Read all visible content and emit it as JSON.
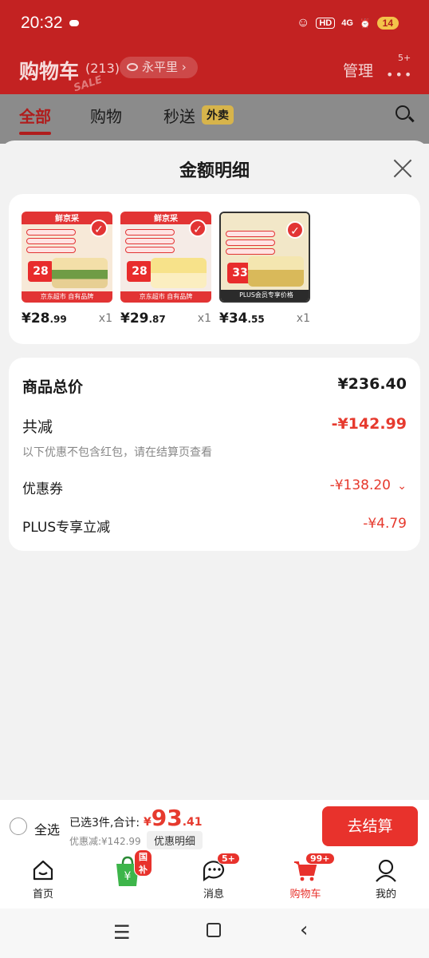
{
  "status_bar": {
    "time": "20:32",
    "hd": "HD",
    "net": "4G",
    "battery": "14"
  },
  "header": {
    "title": "购物车",
    "count": "(213)",
    "location": "永平里",
    "manage": "管理",
    "more_badge": "5+",
    "sale_sticker": "SALE"
  },
  "tabs": [
    {
      "label": "全部",
      "active": true
    },
    {
      "label": "购物",
      "active": false
    },
    {
      "label": "秒送",
      "active": false
    }
  ],
  "tab_badge": "外卖",
  "sheet": {
    "title": "金额明细",
    "products": [
      {
        "banner": "鲜京采",
        "price_int": "¥28",
        "price_dec": ".99",
        "qty": "x1",
        "box": "28",
        "foot": "京东超市 自有品牌"
      },
      {
        "banner": "鲜京采",
        "price_int": "¥29",
        "price_dec": ".87",
        "qty": "x1",
        "box": "28",
        "foot": "京东超市 自有品牌"
      },
      {
        "banner": "",
        "price_int": "¥34",
        "price_dec": ".55",
        "qty": "x1",
        "box": "33",
        "foot": "PLUS会员专享价格"
      }
    ],
    "summary": {
      "total_label": "商品总价",
      "total_value": "¥236.40",
      "discount_label": "共减",
      "discount_value": "-¥142.99",
      "note": "以下优惠不包含红包，请在结算页查看",
      "coupon_label": "优惠券",
      "coupon_value": "-¥138.20",
      "plus_label": "PLUS专享立减",
      "plus_value": "-¥4.79"
    }
  },
  "checkout_bar": {
    "select_all": "全选",
    "selected_info": "已选3件,合计:",
    "total_symbol": "¥",
    "total_int": "93",
    "total_dec": ".41",
    "saved": "优惠减:¥142.99",
    "detail_button": "优惠明细",
    "checkout_button": "去结算"
  },
  "bottom_nav": [
    {
      "label": "首页",
      "badge": ""
    },
    {
      "label": "",
      "badge": "国补"
    },
    {
      "label": "消息",
      "badge": "5+"
    },
    {
      "label": "购物车",
      "badge": "99+"
    },
    {
      "label": "我的",
      "badge": ""
    }
  ],
  "colors": {
    "brand_red": "#c32222",
    "accent_red": "#e63a2e",
    "sheet_bg": "#f2f2f2"
  }
}
